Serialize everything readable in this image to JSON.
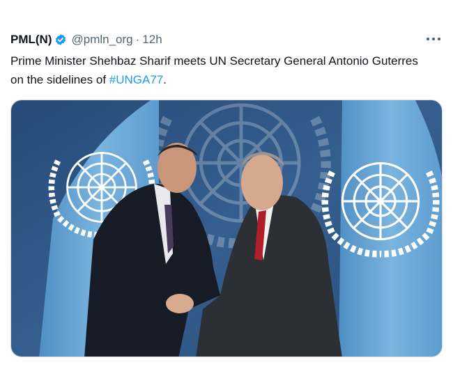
{
  "tweet": {
    "author_name": "PML(N)",
    "handle": "@pmln_org",
    "separator": "·",
    "time": "12h",
    "text_main": "Prime Minister Shehbaz Sharif meets UN Secretary General Antonio Guterres on the sidelines of ",
    "hashtag": "#UNGA77",
    "text_end": ".",
    "verified_icon": "verified-badge-icon",
    "more_icon": "more-options-icon",
    "colors": {
      "verified": "#1d9bf0",
      "hashtag": "#1d9bf0",
      "secondary_text": "#536471"
    }
  },
  "media": {
    "type": "photo",
    "icons": [
      "un-emblem-icon"
    ]
  }
}
